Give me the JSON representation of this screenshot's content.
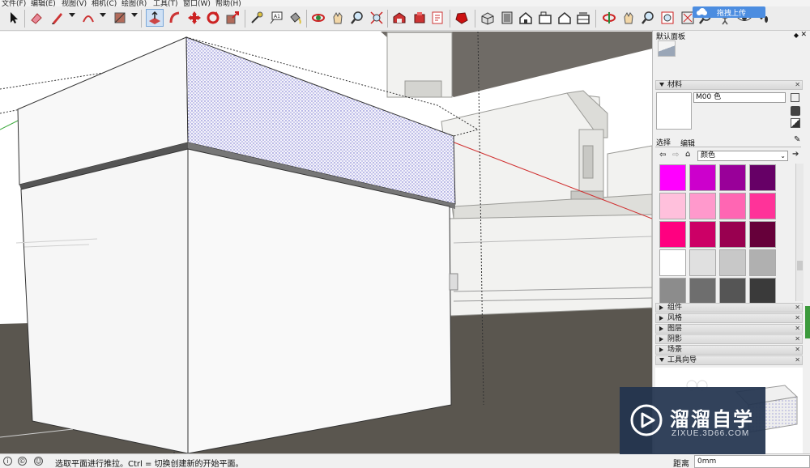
{
  "menu": [
    "文件(F)",
    "编辑(E)",
    "视图(V)",
    "相机(C)",
    "绘图(R)",
    "工具(T)",
    "窗口(W)",
    "帮助(H)"
  ],
  "upload_badge": "拖拽上传",
  "toolbar_icons": [
    "select-icon",
    "eraser-icon",
    "pencil-icon",
    "arc-icon",
    "rectangle-icon",
    "push-pull-icon",
    "follow-me-icon",
    "move-icon",
    "rotate-icon",
    "scale-icon",
    "tape-measure-icon",
    "text-icon",
    "paint-bucket-icon",
    "orbit-icon",
    "pan-icon",
    "zoom-icon",
    "zoom-extents-icon",
    "warehouse-icon",
    "extension-icon",
    "layout-icon",
    "ruby-icon",
    "iso-view-icon",
    "top-view-icon",
    "front-view-icon",
    "right-view-icon",
    "back-view-icon",
    "left-view-icon",
    "walk-icon",
    "look-around-icon",
    "position-camera-icon",
    "section-plane-icon",
    "footprints-icon"
  ],
  "tray": {
    "default_panel": "默认面板",
    "materials_title": "材料",
    "material_name": "M00 色",
    "tab_select": "选择",
    "tab_edit": "编辑",
    "category": "颜色",
    "collapsed_panels": [
      "组件",
      "风格",
      "图层",
      "阴影",
      "场景"
    ],
    "instructor_title": "工具向导"
  },
  "swatches": [
    "#ff00ff",
    "#cc00cc",
    "#990099",
    "#660066",
    "#ffc0dc",
    "#ff99cc",
    "#ff66b3",
    "#ff3399",
    "#ff0080",
    "#cc0066",
    "#990050",
    "#66003a",
    "#ffffff",
    "#e0e0e0",
    "#c8c8c8",
    "#b0b0b0",
    "#8c8c8c",
    "#6e6e6e",
    "#555555",
    "#3a3a3a"
  ],
  "status": {
    "hint": "选取平面进行推拉。Ctrl = 切换创建新的开始平面。",
    "distance_label": "距离",
    "distance_value": "0mm"
  },
  "watermark": {
    "title": "溜溜自学",
    "url": "ZIXUE.3D66.COM"
  }
}
